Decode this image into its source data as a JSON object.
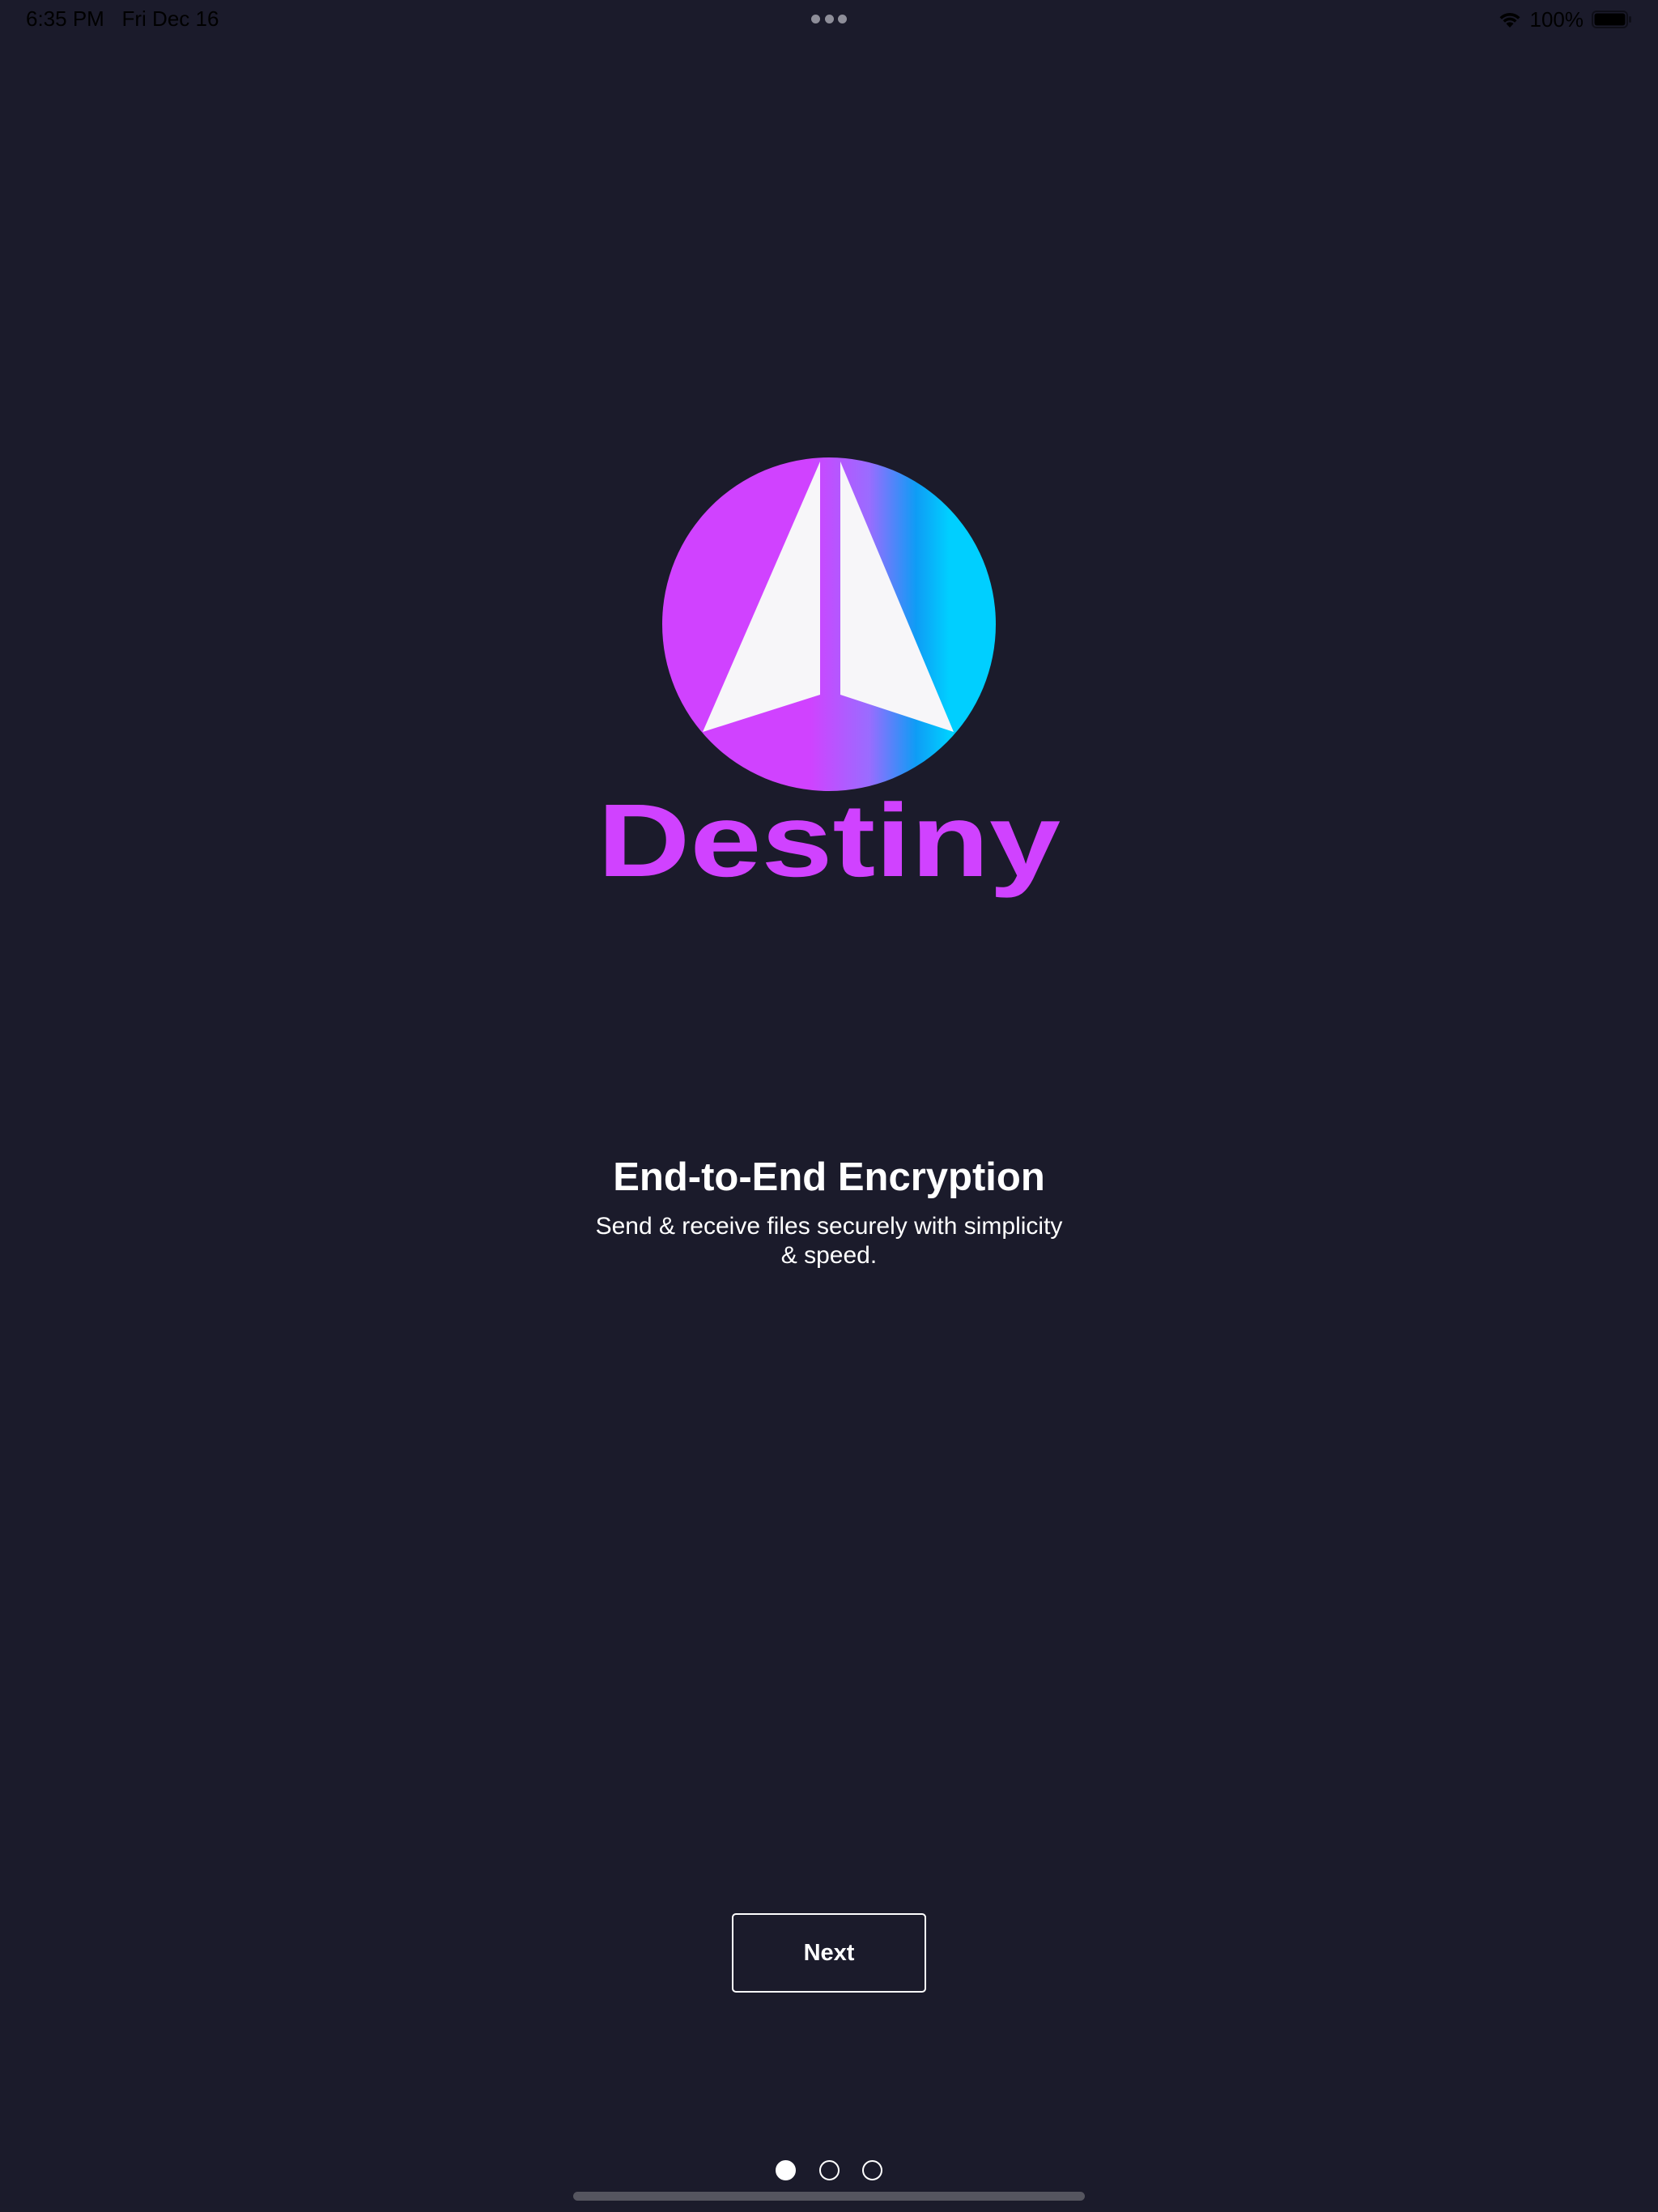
{
  "status_bar": {
    "time": "6:35 PM",
    "date": "Fri Dec 16",
    "battery_percent": "100%",
    "icons": [
      "multitasking-dots-icon",
      "wifi-icon",
      "battery-icon"
    ]
  },
  "logo": {
    "wordmark": "Destiny",
    "emblem_icon": "rocket-arrow-icon",
    "colors": {
      "magenta": "#d042ff",
      "blue": "#0f9cf5",
      "cyan": "#00cfff",
      "arrow": "#f7f6f9"
    }
  },
  "slide": {
    "title": "End-to-End Encryption",
    "subtitle": "Send & receive files securely with simplicity & speed."
  },
  "actions": {
    "next_label": "Next"
  },
  "pager": {
    "total_pages": 3,
    "current_page": 1
  },
  "colors": {
    "background": "#1b1b2b",
    "text": "#ffffff"
  }
}
